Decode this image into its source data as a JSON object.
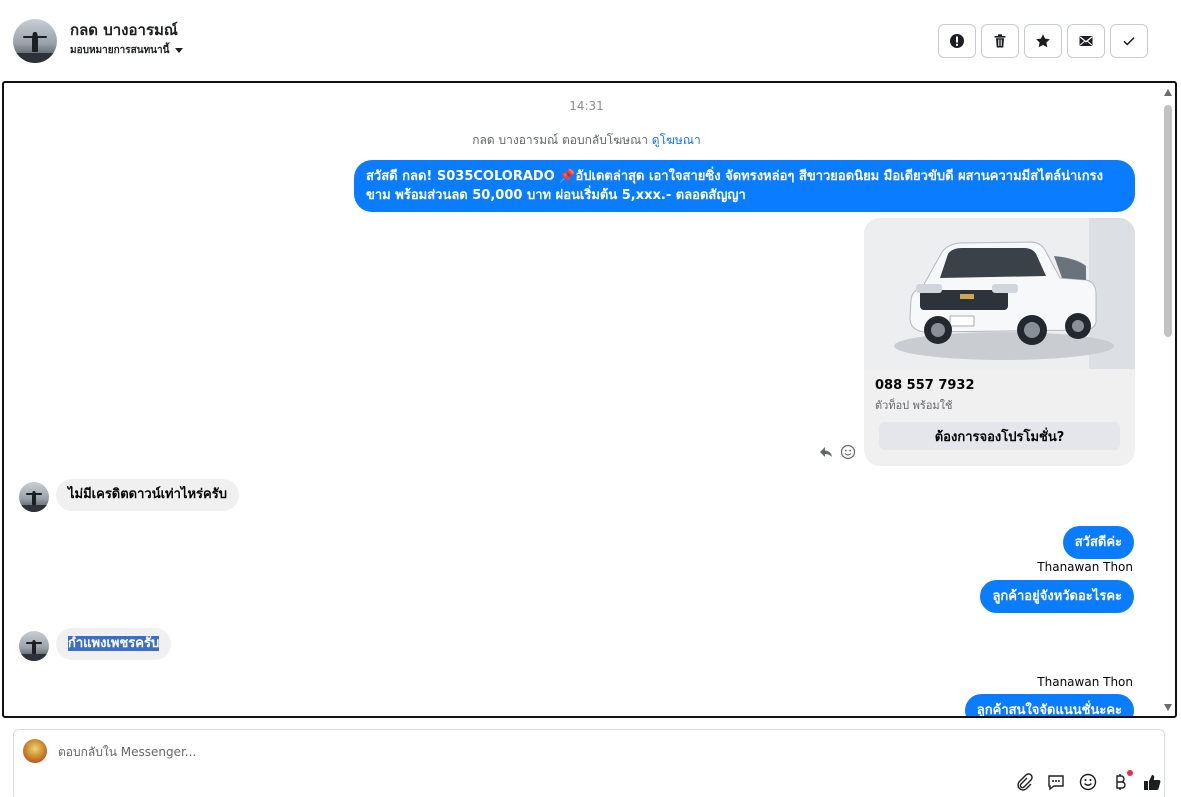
{
  "header": {
    "contact_name": "กลด บางอารมณ์",
    "assign_label": "มอบหมายการสนทนานี้",
    "actions": [
      "spam",
      "delete",
      "star",
      "mark-unread",
      "done"
    ]
  },
  "conversation": {
    "timestamp": "14:31",
    "reply_note": "กลด บางอารมณ์ ตอบกลับโฆษณา",
    "reply_link": "ดูโฆษณา",
    "ad_message": "สวัสดี กลด! S035COLORADO 📌อัปเดตล่าสุด เอาใจสายซิ่ง จัดทรงหล่อๆ สีขาวยอดนิยม มือเดียวขับดี ผสานความมีสไตล์น่าเกรงขาม พร้อมส่วนลด 50,000 บาท ผ่อนเริ่มต้น 5,xxx.- ตลอดสัญญา",
    "ad_message_line1": "สวัสดี กลด! S035COLORADO 📌อัปเดตล่าสุด เอาใจสายซิ่ง จัดทรงหล่อๆ สีขาวยอดนิยม มือเดียวขับดี ผสานความมีสไตล์น่าเกรง",
    "ad_message_line2": "ขาม พร้อมส่วนลด 50,000 บาท ผ่อนเริ่มต้น 5,xxx.- ตลอดสัญญา",
    "card": {
      "phone": "088 557 7932",
      "subtitle": "ตัวท็อป พร้อมใช้",
      "button": "ต้องการจองโปรโมชั่น?"
    },
    "messages": [
      {
        "dir": "in",
        "text": "ไม่มีเครดิตดาวน์เท่าไหร่ครับ"
      },
      {
        "dir": "out",
        "text": "สวัสดีค่ะ"
      },
      {
        "dir": "sender",
        "text": "Thanawan Thon"
      },
      {
        "dir": "out",
        "text": "ลูกค้าอยู่จังหวัดอะไรคะ"
      },
      {
        "dir": "in",
        "text": "กำแพงเพชรครับ"
      },
      {
        "dir": "sender",
        "text": "Thanawan Thon"
      },
      {
        "dir": "out",
        "text": "ลูกค้าสนใจจัดแนนชั่นะคะ"
      }
    ]
  },
  "composer": {
    "placeholder": "ตอบกลับใน Messenger..."
  },
  "colors": {
    "outgoing_bubble": "#0a7cff",
    "incoming_bubble": "#f0f0f0",
    "link": "#1b74e4",
    "notification_dot": "#f02849"
  }
}
